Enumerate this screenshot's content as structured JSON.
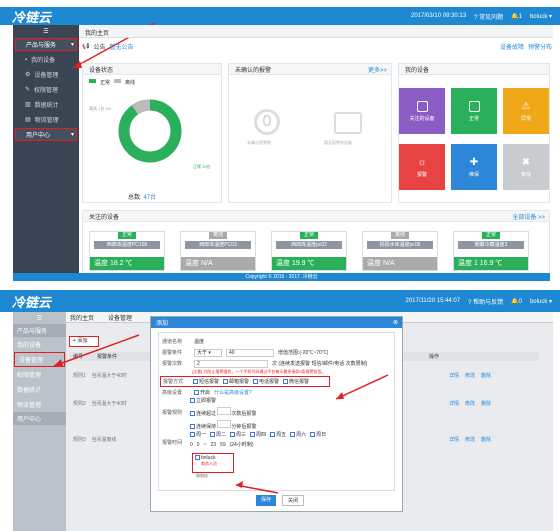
{
  "top": {
    "logo": "冷链云",
    "datetime": "2017/03/10 09:30:13",
    "help": "常见问题",
    "notif": "1",
    "user": "boluck"
  },
  "sidebar": {
    "group1": "产品与服务",
    "items": [
      "我的设备",
      "设备管理",
      "权限管理",
      "数据统计",
      "物流管理"
    ],
    "group2": "用户中心"
  },
  "tabs": {
    "home": "我的主页"
  },
  "notice": {
    "label": "公告",
    "text": "暂无公告",
    "set_right1": "设备故障",
    "set_right2": "预警分布"
  },
  "status": {
    "title": "设备状态",
    "legend_normal": "正常",
    "legend_offline": "离线",
    "offline": "离线 1台 2%",
    "normal": "正常 39台",
    "total_label": "总数: ",
    "total": "47台"
  },
  "alarm": {
    "title": "未确认的报警",
    "more": "更多>>",
    "count": "0",
    "count_sub": "未确认报警数",
    "empty": "暂无报警的设备"
  },
  "mydev": {
    "title": "我的设备",
    "tiles": [
      "关注的设备",
      "正常",
      "异常",
      "报警",
      "维保",
      "离线"
    ]
  },
  "watched": {
    "title": "关注的设备",
    "all": "全部设备 >>",
    "devices": [
      {
        "status": "正常",
        "name": "西郎库温度PC108",
        "value": "温度 18.2 ℃"
      },
      {
        "status": "离线",
        "name": "西郎库温度PC03",
        "value": "温度 N/A"
      },
      {
        "status": "正常",
        "name": "西郎库温度pc02",
        "value": "温度 19.9 ℃"
      },
      {
        "status": "离线",
        "name": "揭阳水库温度pc05",
        "value": "温度 N/A"
      },
      {
        "status": "正常",
        "name": "朝聚冷藏温度3",
        "value": "温度 1 16.9 ℃"
      }
    ]
  },
  "footer1": "Copyright © 2015 - 2017 .冷链云",
  "s2": {
    "datetime": "2017/11/20 15:44:07",
    "help": "帮助与反馈",
    "notif": "0",
    "user": "boluck",
    "tab_home": "我的主页",
    "tab_mgmt": "设备管理",
    "add": "+ 添加",
    "th": [
      "编号",
      "报警条件",
      "操作"
    ],
    "rows": [
      {
        "no": "规则1",
        "cond": "当间温大于40时"
      },
      {
        "no": "规则2",
        "cond": "当间温大于40时"
      },
      {
        "no": "规则3",
        "cond": "当间温离线"
      }
    ],
    "ops": [
      "详情",
      "修改",
      "删除"
    ]
  },
  "dialog": {
    "title": "添加",
    "name_label": "通道名称",
    "name_val": "温度",
    "cond_label": "报警条件",
    "cond_op": "大于",
    "cond_val": "40",
    "cond_hint": "增值范围:(-20℃~70℃)",
    "count_label": "报警次数",
    "count_val": "2",
    "count_hint": "次 (连续发送报警 短信/邮件/电话 次数限制)",
    "warn": "[注意] 为防止报警骚扰，一个手机号码通过平台每天最多接收5条报警短信。",
    "mode_label": "报警方式",
    "modes": [
      "短信报警",
      "邮箱报警",
      "电话报警",
      "微信报警"
    ],
    "adv_label": "高级设置",
    "adv_on": "开启",
    "adv_link": "什么是高级设置?",
    "rule_label": "报警规则",
    "rule1": "立即报警",
    "rule2": "连续超过",
    "rule2b": "次数后报警",
    "rule3": "连续保持",
    "rule3b": "分钟后报警",
    "time_label": "报警时间",
    "days": [
      "周一",
      "周二",
      "周三",
      "周四",
      "周五",
      "周六",
      "周日"
    ],
    "time_from_h": "0",
    "time_from_m": "0",
    "time_to_h": "23",
    "time_to_m": "59",
    "time_hint": "(24小时制)",
    "contact_user": "boluck",
    "contact_sub": "商务人员",
    "contact2": "周和松",
    "save": "保存",
    "close": "关闭"
  }
}
